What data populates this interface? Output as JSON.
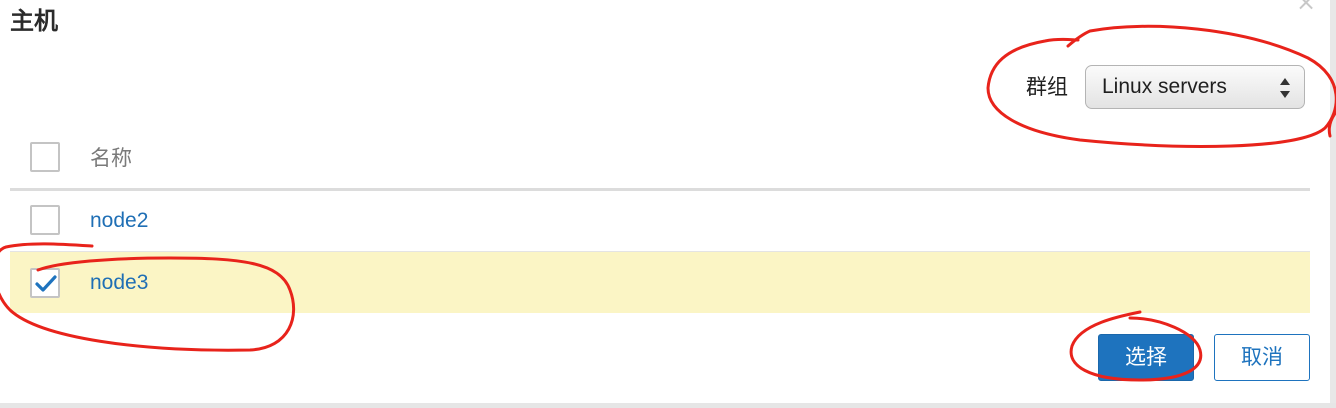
{
  "dialog": {
    "title": "主机",
    "close_icon": "close-icon"
  },
  "filter": {
    "label": "群组",
    "selected": "Linux servers"
  },
  "table": {
    "header": "名称",
    "rows": [
      {
        "name": "node2",
        "checked": false
      },
      {
        "name": "node3",
        "checked": true
      }
    ]
  },
  "actions": {
    "select_label": "选择",
    "cancel_label": "取消"
  },
  "colors": {
    "accent": "#1e73be",
    "selected_row": "#fbf5c5",
    "annotation_marker": "#e8231b"
  }
}
